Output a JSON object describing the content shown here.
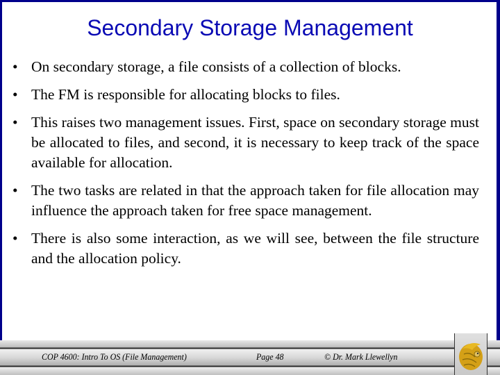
{
  "slide": {
    "title": "Secondary Storage Management",
    "bullets": [
      {
        "symbol": "•",
        "text": "On secondary storage, a file consists of a collection of blocks."
      },
      {
        "symbol": "•",
        "text": "The FM is responsible for allocating blocks to files."
      },
      {
        "symbol": "•",
        "text": "This raises two management issues.  First, space on secondary storage must be allocated to files, and second, it is necessary to keep track of the space available for allocation."
      },
      {
        "symbol": "•",
        "text": "The two tasks are related in that the approach taken for file allocation may influence the approach taken for free space management."
      },
      {
        "symbol": "•",
        "text": "There is also some interaction, as we will see, between the file structure and the allocation policy."
      }
    ]
  },
  "footer": {
    "course": "COP 4600: Intro To OS  (File Management)",
    "page": "Page 48",
    "copyright": "© Dr. Mark Llewellyn",
    "logo_icon": "pegasus-logo-icon"
  },
  "colors": {
    "frame": "#00008b",
    "title": "#0a0ab4",
    "logo_gold": "#d4a017"
  }
}
